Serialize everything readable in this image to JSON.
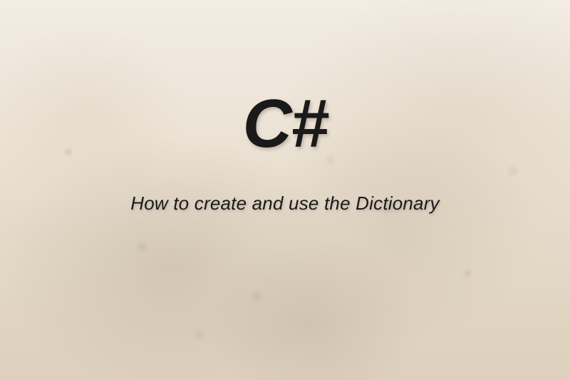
{
  "title": "C#",
  "subtitle": "How to create and use the Dictionary"
}
